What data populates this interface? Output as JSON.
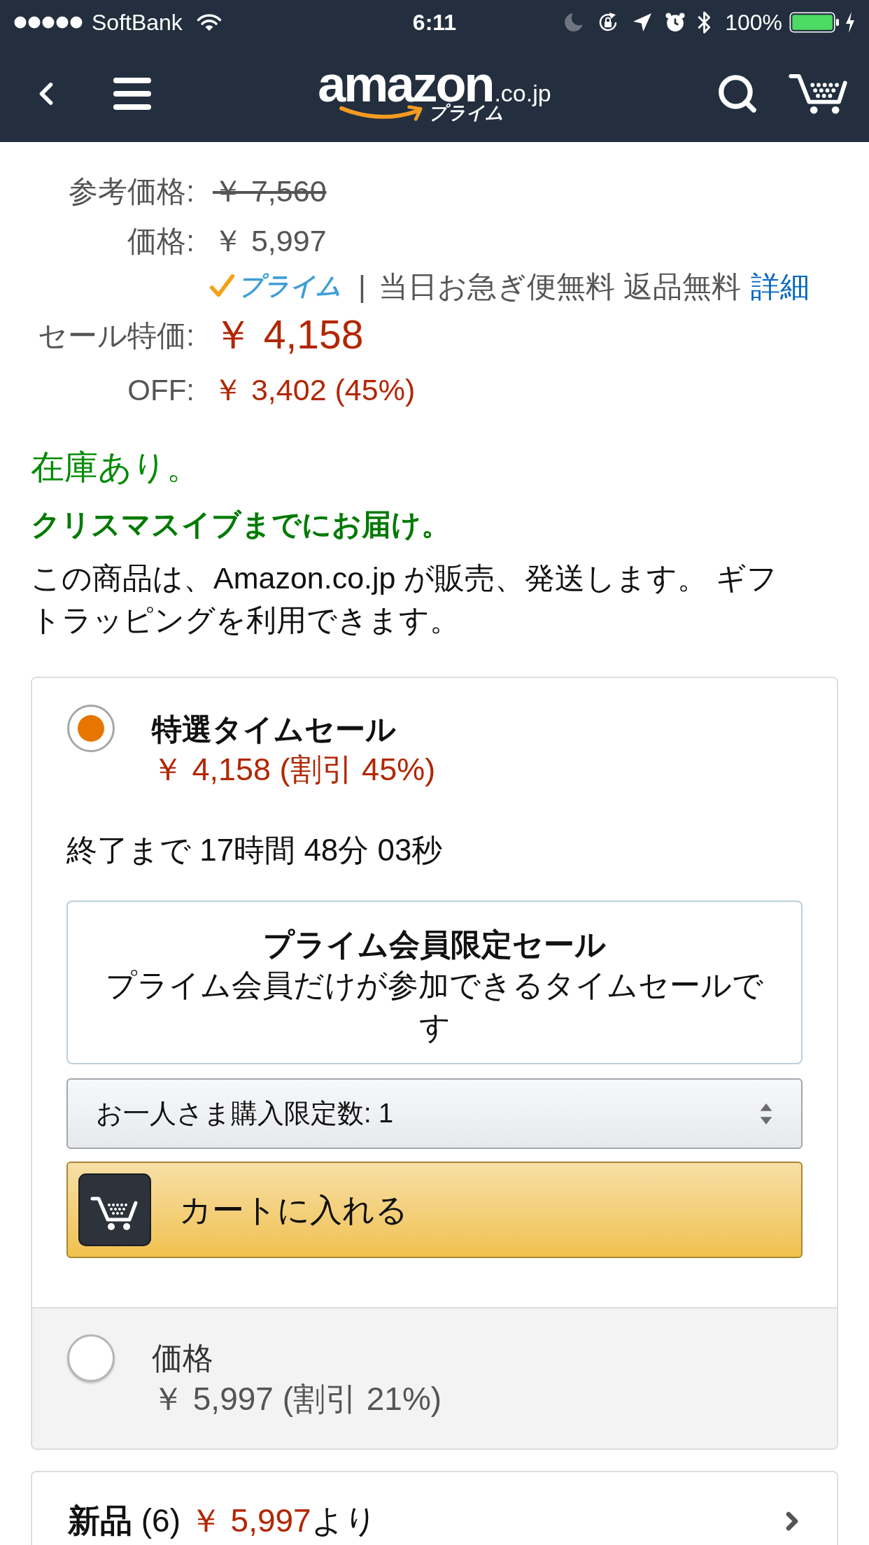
{
  "status_bar": {
    "carrier": "SoftBank",
    "time": "6:11",
    "battery": "100%"
  },
  "header": {
    "logo": {
      "wordmark": "amazon",
      "domain": ".co.jp",
      "tagline": "プライム"
    }
  },
  "price_rows": [
    {
      "kind": "list",
      "label": "参考価格:",
      "value": "￥ 7,560"
    },
    {
      "kind": "price",
      "label": "価格:",
      "value": "￥ 5,997"
    },
    {
      "kind": "prime",
      "badge": "プライム",
      "separator": "|",
      "text": "当日お急ぎ便無料 返品無料",
      "link": "詳細"
    },
    {
      "kind": "sale",
      "label": "セール特価:",
      "value": "￥ 4,158"
    },
    {
      "kind": "savings",
      "label": "OFF:",
      "value": "￥ 3,402 (45%)"
    }
  ],
  "stock": {
    "availability": "在庫あり。",
    "delivery": "クリスマスイブまでにお届け。",
    "seller_note": "この商品は、Amazon.co.jp が販売、発送します。 ギフトラッピングを利用できます。"
  },
  "offers": [
    {
      "kind": "deal",
      "selected": true,
      "title": "特選タイムセール",
      "price": "￥ 4,158 (割引 45%)",
      "countdown": "終了まで 17時間 48分 03秒",
      "notice": {
        "title": "プライム会員限定セール",
        "text": "プライム会員だけが参加できるタイムセールです"
      },
      "quantity": "お一人さま購入限定数: 1",
      "cart_button": "カートに入れる"
    },
    {
      "kind": "regular",
      "selected": false,
      "title": "価格",
      "price": "￥ 5,997 (割引 21%)"
    }
  ],
  "new_offers": {
    "label": "新品",
    "count": "(6)",
    "price": "￥ 5,997",
    "suffix": "より"
  }
}
